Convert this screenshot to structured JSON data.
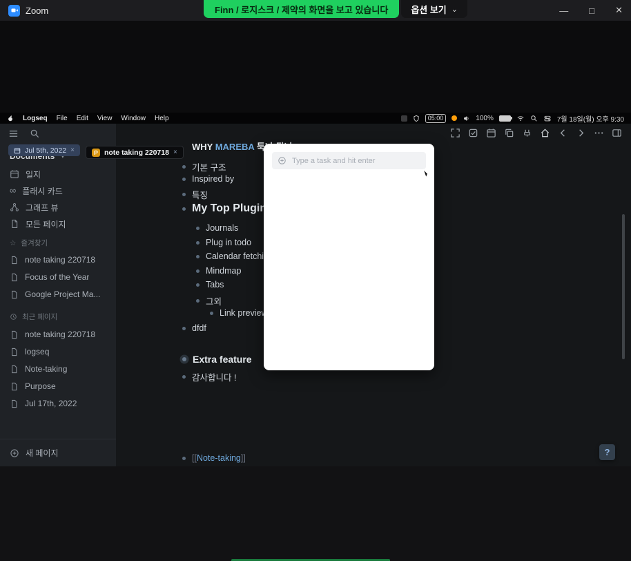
{
  "zoom": {
    "title": "Zoom",
    "banner": {
      "text": "Finn / 로지스크 / 제약의 화면을 보고 있습니다",
      "options_label": "옵션 보기"
    }
  },
  "ui": {
    "close_glyph": "×",
    "caret_down": "⌄",
    "caret_small": "▾",
    "win_min": "—",
    "win_max": "□",
    "win_close": "✕",
    "infinity": "∞",
    "star": "☆",
    "question": "?"
  },
  "menubar": {
    "items": [
      "Logseq",
      "File",
      "Edit",
      "View",
      "Window",
      "Help"
    ],
    "status": {
      "timer": "05:00",
      "battery": "100%",
      "datetime": "7월 18일(월) 오후 9:30"
    }
  },
  "sidebar": {
    "documents_label": "Documents",
    "nav": [
      {
        "label": "일지"
      },
      {
        "label": "플래시 카드"
      },
      {
        "label": "그래프 뷰"
      },
      {
        "label": "모든 페이지"
      }
    ],
    "favorites": {
      "header": "즐겨찾기",
      "items": [
        "note taking 220718",
        "Focus of the Year",
        "Google Project Ma..."
      ]
    },
    "recent": {
      "header": "최근 페이지",
      "items": [
        "note taking 220718",
        "logseq",
        "Note-taking",
        "Purpose",
        "Jul 17th, 2022"
      ]
    },
    "new_page_label": "새 페이지"
  },
  "tabs": [
    {
      "label": "Jul 5th, 2022"
    },
    {
      "label": "note taking 220718",
      "badge": "P"
    }
  ],
  "content": {
    "heading_prefix": "WHY ",
    "heading_link": "MAREBA",
    "heading_suffix": " 둑나 됩니 !!",
    "bullets1": [
      "기본 구조",
      "Inspired by",
      "특징"
    ],
    "section_title": "My Top Plugins in logseq",
    "plugins": [
      "Journals",
      "Plug in todo",
      "Calendar fetching",
      "Mindmap",
      "Tabs",
      "그외"
    ],
    "sub_plugin": "Link preview",
    "dfdf": "dfdf",
    "extra_title": "Extra feature",
    "thanks": "감사합니다 !",
    "link_open": "[[",
    "link_text": "Note-taking",
    "link_close": "]]"
  },
  "task_popup": {
    "placeholder": "Type a task and hit enter"
  },
  "colors": {
    "banner_green": "#1fd05f",
    "tab_badge_orange": "#d89614",
    "link_blue": "#6ea8dc"
  }
}
